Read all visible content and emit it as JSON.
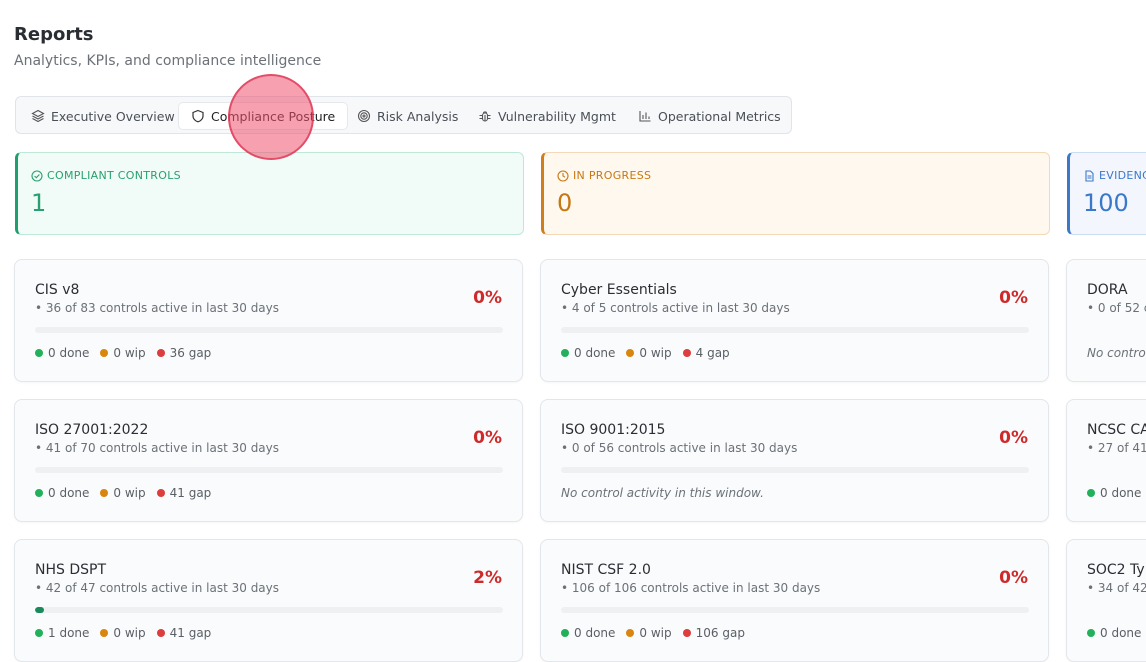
{
  "page": {
    "title": "Reports",
    "subtitle": "Analytics, KPIs, and compliance intelligence"
  },
  "tabs": [
    {
      "label": "Executive Overview",
      "icon": "layers-icon"
    },
    {
      "label": "Compliance Posture",
      "icon": "shield-icon",
      "active": true
    },
    {
      "label": "Risk Analysis",
      "icon": "target-icon"
    },
    {
      "label": "Vulnerability Mgmt",
      "icon": "bug-icon"
    },
    {
      "label": "Operational Metrics",
      "icon": "bar-chart-icon"
    }
  ],
  "kpis": [
    {
      "label": "COMPLIANT CONTROLS",
      "value": "1",
      "icon": "check-circle-icon",
      "color": "#28a071"
    },
    {
      "label": "IN PROGRESS",
      "value": "0",
      "icon": "clock-icon",
      "color": "#c77712"
    },
    {
      "label": "EVIDENC",
      "value": "100",
      "icon": "document-icon",
      "color": "#3a78c9"
    }
  ],
  "frameworks": [
    {
      "name": "CIS v8",
      "sub": "• 36 of 83 controls active in last 30 days",
      "pct": "0%",
      "progress": 0,
      "done": "0 done",
      "wip": "0 wip",
      "gap": "36 gap"
    },
    {
      "name": "Cyber Essentials",
      "sub": "• 4 of 5 controls active in last 30 days",
      "pct": "0%",
      "progress": 0,
      "done": "0 done",
      "wip": "0 wip",
      "gap": "4 gap"
    },
    {
      "name": "DORA",
      "sub": "• 0 of 52 c",
      "empty": "No contro"
    },
    {
      "name": "ISO 27001:2022",
      "sub": "• 41 of 70 controls active in last 30 days",
      "pct": "0%",
      "progress": 0,
      "done": "0 done",
      "wip": "0 wip",
      "gap": "41 gap"
    },
    {
      "name": "ISO 9001:2015",
      "sub": "• 0 of 56 controls active in last 30 days",
      "pct": "0%",
      "progress": 0,
      "empty": "No control activity in this window."
    },
    {
      "name": "NCSC CA",
      "sub": "• 27 of 41 c",
      "done": "0 done"
    },
    {
      "name": "NHS DSPT",
      "sub": "• 42 of 47 controls active in last 30 days",
      "pct": "2%",
      "progress": 0.02,
      "done": "1 done",
      "wip": "0 wip",
      "gap": "41 gap"
    },
    {
      "name": "NIST CSF 2.0",
      "sub": "• 106 of 106 controls active in last 30 days",
      "pct": "0%",
      "progress": 0,
      "done": "0 done",
      "wip": "0 wip",
      "gap": "106 gap"
    },
    {
      "name": "SOC2 Ty",
      "sub": "• 34 of 42",
      "done": "0 done"
    }
  ]
}
